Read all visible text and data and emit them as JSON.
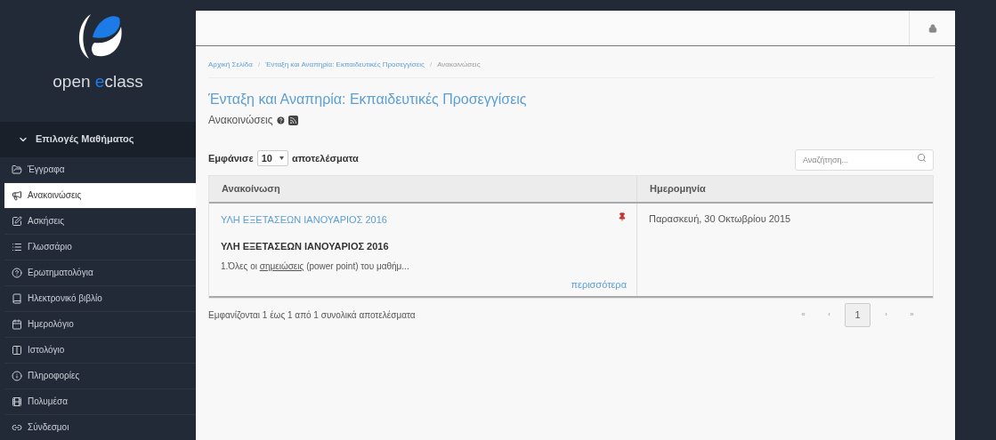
{
  "logo": {
    "parts": [
      {
        "text": "open ",
        "accent": false
      },
      {
        "text": "e",
        "accent": true
      },
      {
        "text": "class",
        "accent": false
      }
    ]
  },
  "sidebar": {
    "header": {
      "label": "Επιλογές Μαθήματος",
      "expanded": true
    },
    "items": [
      {
        "label": "Έγγραφα",
        "selected": false
      },
      {
        "label": "Ανακοινώσεις",
        "selected": true
      },
      {
        "label": "Ασκήσεις",
        "selected": false
      },
      {
        "label": "Γλωσσάριο",
        "selected": false
      },
      {
        "label": "Ερωτηματολόγια",
        "selected": false
      },
      {
        "label": "Ηλεκτρονικό βιβλίο",
        "selected": false
      },
      {
        "label": "Ημερολόγιο",
        "selected": false
      },
      {
        "label": "Ιστολόγιο",
        "selected": false
      },
      {
        "label": "Πληροφορίες",
        "selected": false
      },
      {
        "label": "Πολυμέσα",
        "selected": false
      },
      {
        "label": "Σύνδεσμοι",
        "selected": false
      }
    ]
  },
  "breadcrumb": [
    {
      "kind": "link",
      "text": "Αρχική Σελίδα"
    },
    {
      "kind": "separator",
      "text": "/"
    },
    {
      "kind": "link",
      "text": "Ένταξη και Αναπηρία: Εκπαιδευτικές Προσεγγίσεις"
    },
    {
      "kind": "separator",
      "text": "/"
    },
    {
      "kind": "current",
      "text": "Ανακοινώσεις"
    }
  ],
  "course_title": "Ένταξη και Αναπηρία: Εκπαιδευτικές Προσεγγίσεις",
  "section_title": "Ανακοινώσεις",
  "length_control": {
    "before": "Εμφάνισε",
    "value": "10",
    "after": "αποτελέσματα"
  },
  "search": {
    "placeholder": "Αναζήτηση..."
  },
  "table": {
    "columns": [
      "Ανακοίνωση",
      "Ημερομηνία"
    ],
    "rows": [
      {
        "title": "ΥΛΗ ΕΞΕΤΑΣΕΩΝ ΙΑΝΟΥΑΡΙΟΣ 2016",
        "pinned": true,
        "heading": "ΥΛΗ ΕΞΕΤΑΣΕΩΝ ΙΑΝΟΥΑΡΙΟΣ 2016",
        "excerpt_before": "1.Όλες οι ",
        "excerpt_link": "σημειώσεις",
        "excerpt_after": " (power point) του μαθήμ...",
        "more": "περισσότερα",
        "date": "Παρασκευή, 30 Οκτωβρίου 2015"
      }
    ]
  },
  "info": "Εμφανίζονται 1 έως 1 από 1 συνολικά αποτελέσματα",
  "pagination": [
    {
      "label": "«",
      "selected": false
    },
    {
      "label": "‹",
      "selected": false
    },
    {
      "label": "1",
      "selected": true
    },
    {
      "label": "›",
      "selected": false
    },
    {
      "label": "»",
      "selected": false
    }
  ]
}
